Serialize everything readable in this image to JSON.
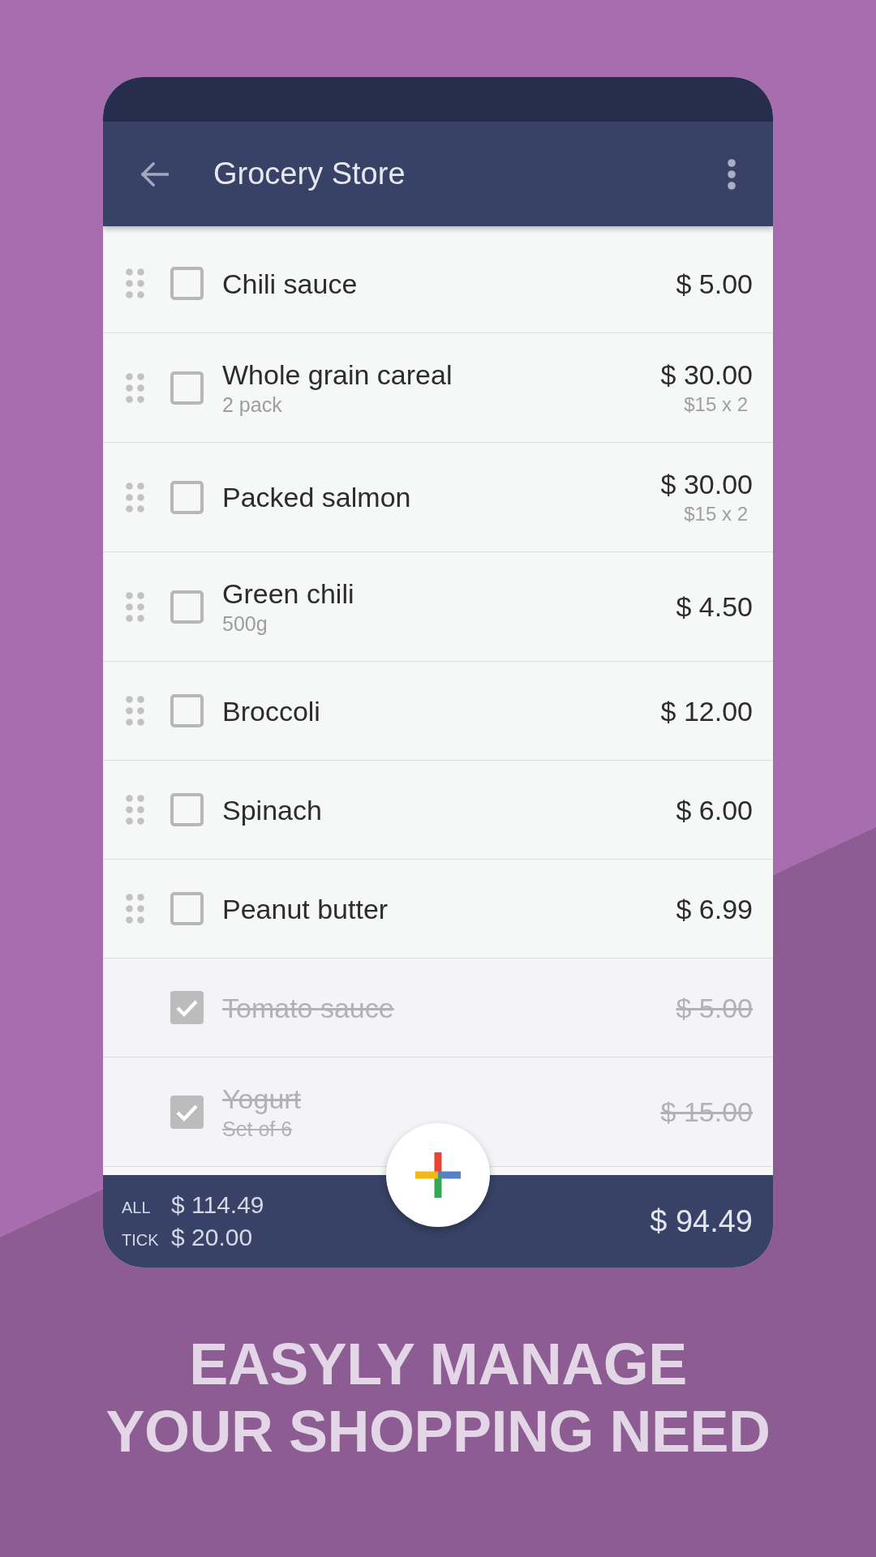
{
  "app_bar": {
    "title": "Grocery Store"
  },
  "items": [
    {
      "name": "Chili sauce",
      "price": "$ 5.00",
      "checked": false
    },
    {
      "name": "Whole grain careal",
      "note": "2 pack",
      "price": "$ 30.00",
      "unit_price": "$15 x 2",
      "checked": false
    },
    {
      "name": "Packed salmon",
      "price": "$ 30.00",
      "unit_price": "$15 x 2",
      "checked": false
    },
    {
      "name": "Green chili",
      "note": "500g",
      "price": "$ 4.50",
      "checked": false
    },
    {
      "name": "Broccoli",
      "price": "$ 12.00",
      "checked": false
    },
    {
      "name": "Spinach",
      "price": "$ 6.00",
      "checked": false
    },
    {
      "name": "Peanut butter",
      "price": "$ 6.99",
      "checked": false
    },
    {
      "name": "Tomato sauce",
      "price": "$ 5.00",
      "checked": true
    },
    {
      "name": "Yogurt",
      "note": "Set of 6",
      "price": "$ 15.00",
      "checked": true
    }
  ],
  "totals": {
    "all_label": "ALL",
    "all_value": "$ 114.49",
    "tick_label": "TICK",
    "tick_value": "$ 20.00",
    "balance": "$ 94.49"
  },
  "headline": [
    "EASYLY MANAGE",
    "YOUR SHOPPING NEED"
  ]
}
